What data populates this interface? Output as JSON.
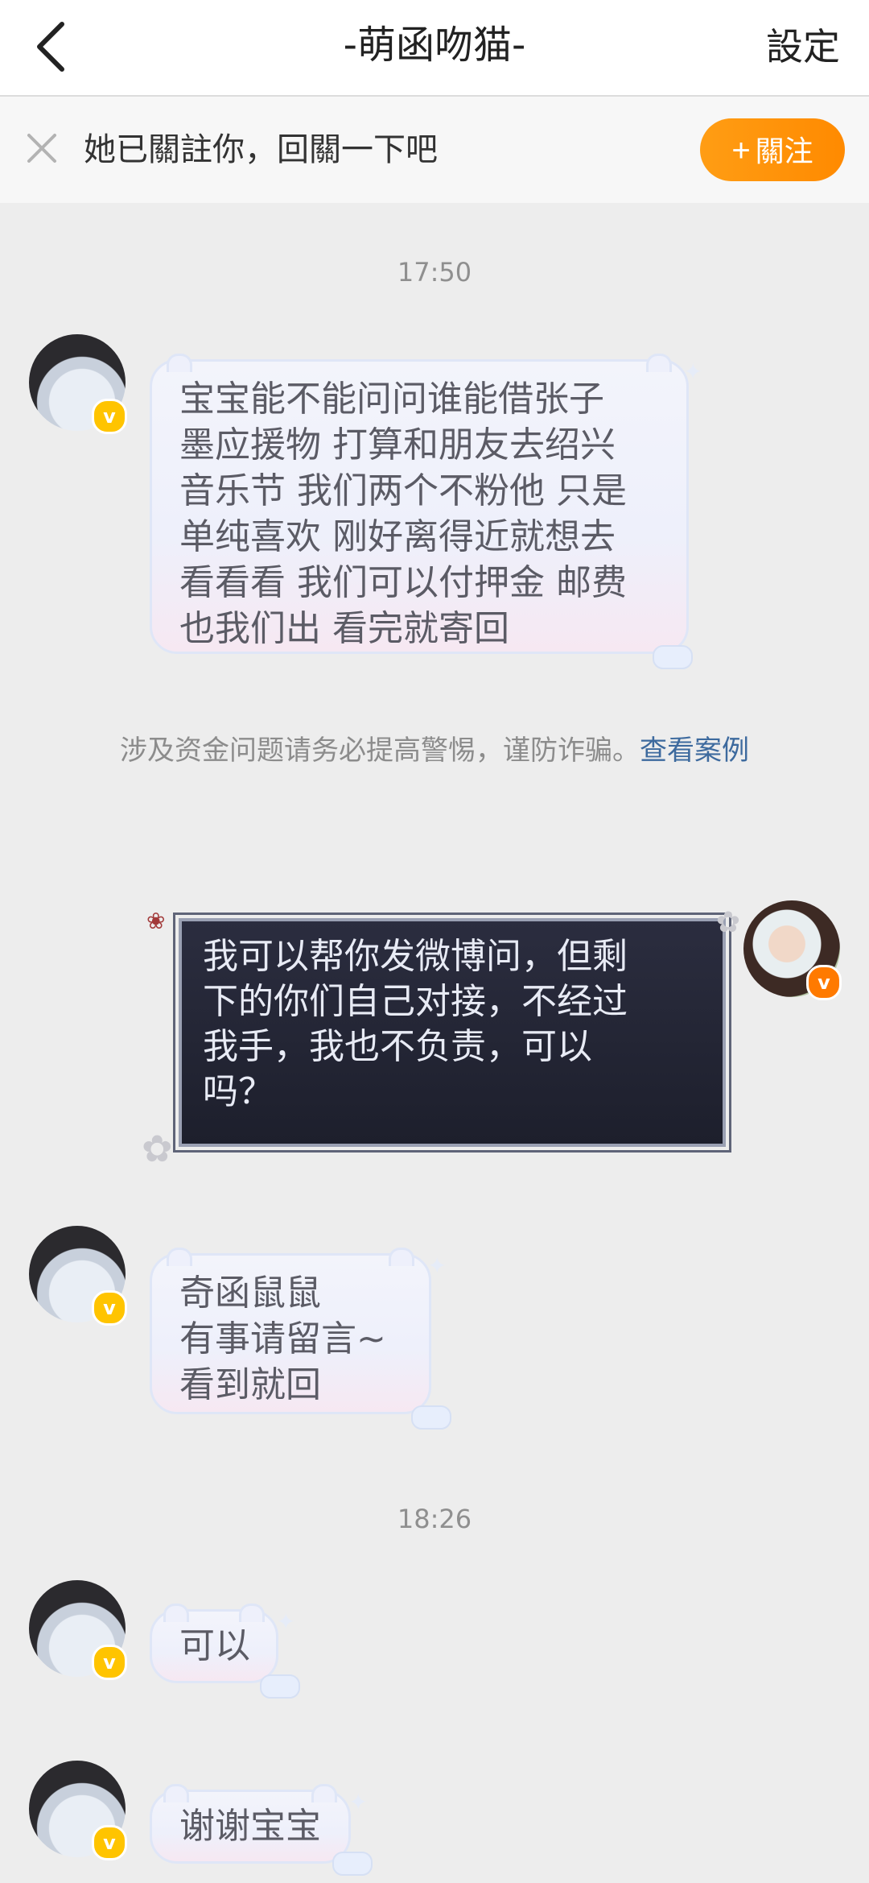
{
  "header": {
    "title": "-萌函吻猫-",
    "settings_label": "設定"
  },
  "follow_bar": {
    "text": "她已關註你，回關一下吧",
    "button_label": "關注",
    "button_icon": "plus-icon"
  },
  "warning": {
    "text": "涉及资金问题请务必提高警惕，谨防诈骗。",
    "link": "查看案例"
  },
  "timestamps": [
    "17:50",
    "18:26"
  ],
  "messages": [
    {
      "direction": "incoming",
      "lines": [
        "宝宝能不能问问谁能借张子",
        "墨应援物 打算和朋友去绍兴",
        "音乐节 我们两个不粉他 只是",
        "单纯喜欢 刚好离得近就想去",
        "看看看 我们可以付押金 邮费",
        "也我们出 看完就寄回"
      ]
    },
    {
      "direction": "outgoing",
      "lines": [
        "我可以帮你发微博问，但剩",
        "下的你们自己对接，不经过",
        "我手，我也不负责，可以",
        "吗？"
      ]
    },
    {
      "direction": "incoming",
      "lines": [
        "奇函鼠鼠",
        "有事请留言~",
        "看到就回"
      ]
    },
    {
      "direction": "incoming",
      "lines": [
        "可以"
      ]
    },
    {
      "direction": "incoming",
      "lines": [
        "谢谢宝宝"
      ]
    }
  ],
  "colors": {
    "follow_button": "#ff9100",
    "link": "#3d6a9e",
    "verified_badge_left": "#ffc400",
    "verified_badge_right": "#ff7a00"
  }
}
